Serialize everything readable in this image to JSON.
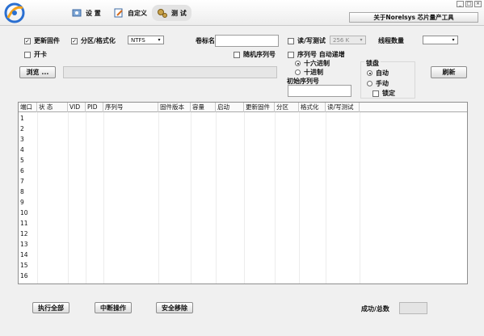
{
  "tabs": [
    {
      "label": "设 置",
      "icon": "gear-wrench-icon"
    },
    {
      "label": "自定义",
      "icon": "edit-page-icon"
    },
    {
      "label": "测 试",
      "icon": "gears-icon"
    }
  ],
  "app_title": "关于Norelsys 芯片量产工具",
  "window_controls": {
    "minimize": "_",
    "maximize": "□",
    "close": "×"
  },
  "options": {
    "update_firmware": {
      "label": "更新固件",
      "checked": true
    },
    "partition_format": {
      "label": "分区/格式化",
      "checked": true
    },
    "fs_select": {
      "value": "NTFS"
    },
    "volume_label": {
      "label": "卷标名",
      "value": ""
    },
    "rw_test": {
      "label": "读/写测试",
      "checked": false
    },
    "rw_size": {
      "value": "256 K"
    },
    "thread_count": {
      "label": "线程数量",
      "value": ""
    },
    "open_card": {
      "label": "开卡",
      "checked": false
    },
    "random_serial": {
      "label": "随机序列号",
      "checked": false
    },
    "serial_auto_inc": {
      "label": "序列号 自动递增",
      "checked": false
    },
    "hex": {
      "label": "十六进制",
      "selected": true
    },
    "dec": {
      "label": "十进制",
      "selected": false
    },
    "initial_serial": {
      "label": "初始序列号",
      "value": ""
    },
    "lock_group": {
      "label": "锁盘"
    },
    "lock_auto": {
      "label": "自动",
      "selected": true
    },
    "lock_manual": {
      "label": "手动",
      "selected": false
    },
    "lock_lock": {
      "label": "锁定",
      "checked": false
    }
  },
  "browse_button": "浏览 ...",
  "file_path": "",
  "refresh_button": "刷新",
  "table": {
    "columns": [
      "端口",
      "状  态",
      "VID",
      "PID",
      "序列号",
      "固件版本",
      "容量",
      "启动",
      "更新固件",
      "分区",
      "格式化",
      "读/写测试"
    ],
    "rows": [
      "1",
      "2",
      "3",
      "4",
      "5",
      "6",
      "7",
      "8",
      "9",
      "10",
      "11",
      "12",
      "13",
      "14",
      "15",
      "16"
    ]
  },
  "footer": {
    "run_all": "执行全部",
    "interrupt": "中断操作",
    "safe_remove": "安全移除",
    "success_total_label": "成功/总数",
    "success_total_value": ""
  }
}
